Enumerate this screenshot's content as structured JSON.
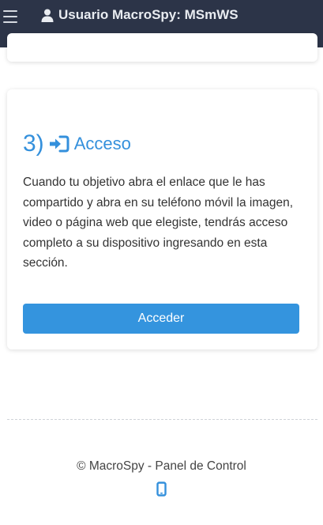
{
  "header": {
    "menu_icon": "hamburger-menu-icon",
    "user_icon": "user-icon",
    "title": "Usuario MacroSpy: MSmWS",
    "background_color": "#2c3448"
  },
  "step": {
    "number": "3)",
    "icon": "sign-in-icon",
    "title": "Acceso",
    "description": "Cuando tu objetivo abra el enlace que le has compartido y abra en su teléfono móvil la imagen, video o página web que elegiste, tendrás acceso completo a su dispositivo ingresando en esta sección.",
    "button_label": "Acceder",
    "accent_color": "#3490dc"
  },
  "footer": {
    "text": "© MacroSpy - Panel de Control",
    "icon": "mobile-phone-icon"
  }
}
